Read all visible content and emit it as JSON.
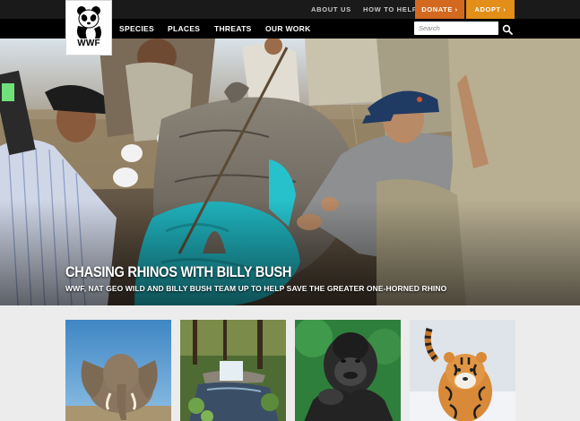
{
  "site": {
    "logo_text": "WWF"
  },
  "utility_nav": {
    "about": "ABOUT US",
    "help": "HOW TO HELP",
    "donate": "DONATE ›",
    "adopt": "ADOPT ›"
  },
  "main_nav": {
    "items": [
      "SPECIES",
      "PLACES",
      "THREATS",
      "OUR WORK"
    ]
  },
  "search": {
    "placeholder": "Search"
  },
  "hero": {
    "title": "CHASING RHINOS WITH BILLY BUSH",
    "subtitle": "WWF, NAT GEO WILD AND BILLY BUSH TEAM UP TO HELP SAVE THE GREATER ONE-HORNED RHINO"
  },
  "thumbnails": [
    {
      "subject": "elephant"
    },
    {
      "subject": "waterfall"
    },
    {
      "subject": "gorilla"
    },
    {
      "subject": "tiger"
    }
  ],
  "colors": {
    "donate": "#d3691f",
    "adopt": "#e38e19",
    "topbar": "#1a1a1a",
    "navbar": "#000000"
  }
}
